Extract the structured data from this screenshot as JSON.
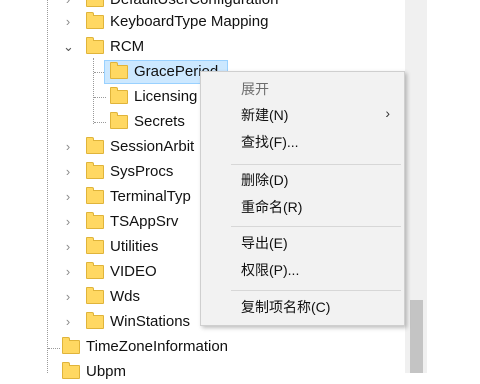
{
  "tree": {
    "items": [
      {
        "label": "DefaultUserConfiguration"
      },
      {
        "label": "KeyboardType Mapping"
      },
      {
        "label": "RCM"
      },
      {
        "label": "GracePeriod"
      },
      {
        "label": "Licensing"
      },
      {
        "label": "Secrets"
      },
      {
        "label": "SessionArbit"
      },
      {
        "label": "SysProcs"
      },
      {
        "label": "TerminalTyp"
      },
      {
        "label": "TSAppSrv"
      },
      {
        "label": "Utilities"
      },
      {
        "label": "VIDEO"
      },
      {
        "label": "Wds"
      },
      {
        "label": "WinStations"
      },
      {
        "label": "TimeZoneInformation"
      },
      {
        "label": "Ubpm"
      }
    ]
  },
  "context_menu": {
    "expand": "展开",
    "new": "新建(N)",
    "find": "查找(F)...",
    "delete": "删除(D)",
    "rename": "重命名(R)",
    "export": "导出(E)",
    "permissions": "权限(P)...",
    "copy_key_name": "复制项名称(C)"
  },
  "icons": {
    "expander_collapsed": "chevron-right-icon",
    "expander_expanded": "chevron-down-icon",
    "folder": "folder-icon",
    "submenu": "chevron-right-icon"
  },
  "colors": {
    "selection_bg": "#cce8ff",
    "folder": "#ffd862",
    "menu_bg": "#f2f2f2"
  }
}
